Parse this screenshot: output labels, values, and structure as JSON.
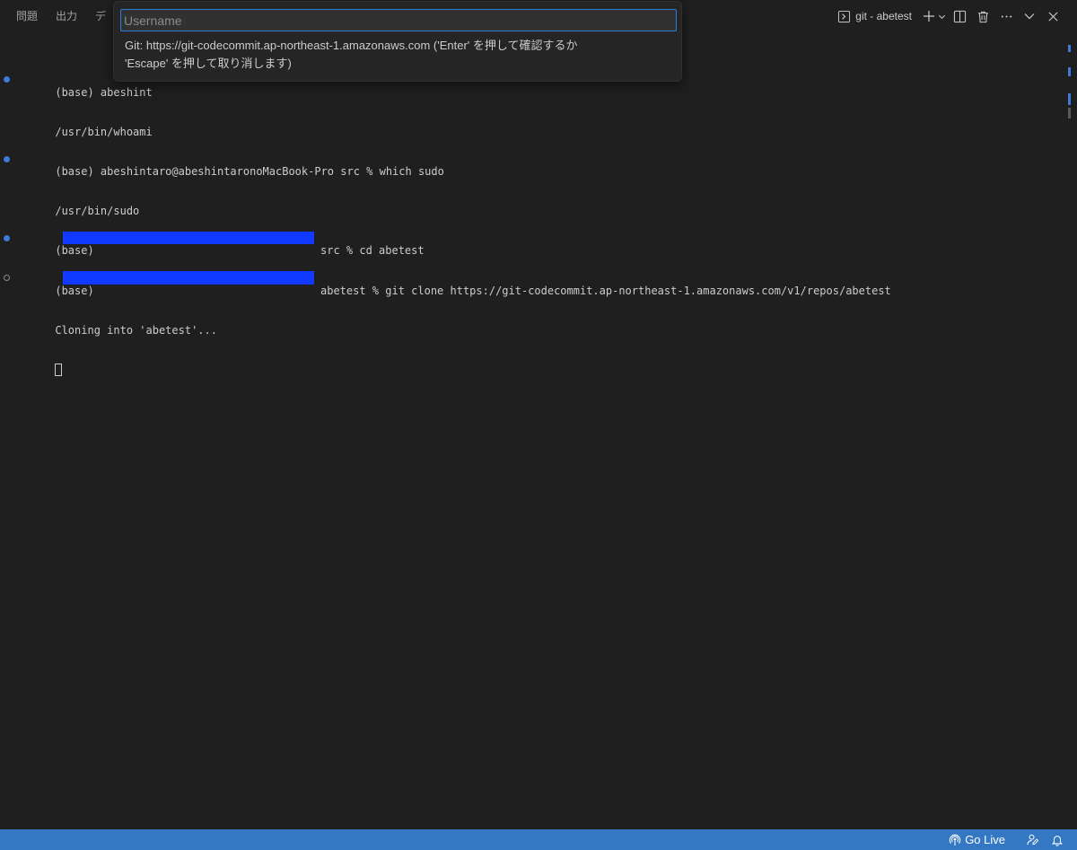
{
  "panel": {
    "tabs": [
      {
        "label": "問題"
      },
      {
        "label": "出力"
      },
      {
        "label": "デ"
      }
    ],
    "terminal_name": "git - abetest"
  },
  "terminal": {
    "lines": [
      {
        "prefix": "(base) abeshint",
        "rest": ""
      },
      {
        "prefix": "/usr/bin/whoami",
        "rest": ""
      },
      {
        "prefix": "(base) abeshintaro@abeshintaronoMacBook-Pro src % which sudo",
        "rest": ""
      },
      {
        "prefix": "/usr/bin/sudo",
        "rest": ""
      },
      {
        "prefix": "(base) ",
        "rest": "src % cd abetest"
      },
      {
        "prefix": "(base) ",
        "rest": "abetest % git clone https://git-codecommit.ap-northeast-1.amazonaws.com/v1/repos/abetest"
      },
      {
        "prefix": "Cloning into 'abetest'...",
        "rest": ""
      }
    ]
  },
  "quick_input": {
    "placeholder": "Username",
    "value": "",
    "message": "Git: https://git-codecommit.ap-northeast-1.amazonaws.com ('Enter' を押して確認するか\n'Escape' を押して取り消します)"
  },
  "statusbar": {
    "go_live": "Go Live"
  },
  "colors": {
    "accent": "#2b7dd6",
    "statusbar": "#3478c4",
    "redaction": "#1139ff",
    "decoration": "#3e7bd6"
  }
}
